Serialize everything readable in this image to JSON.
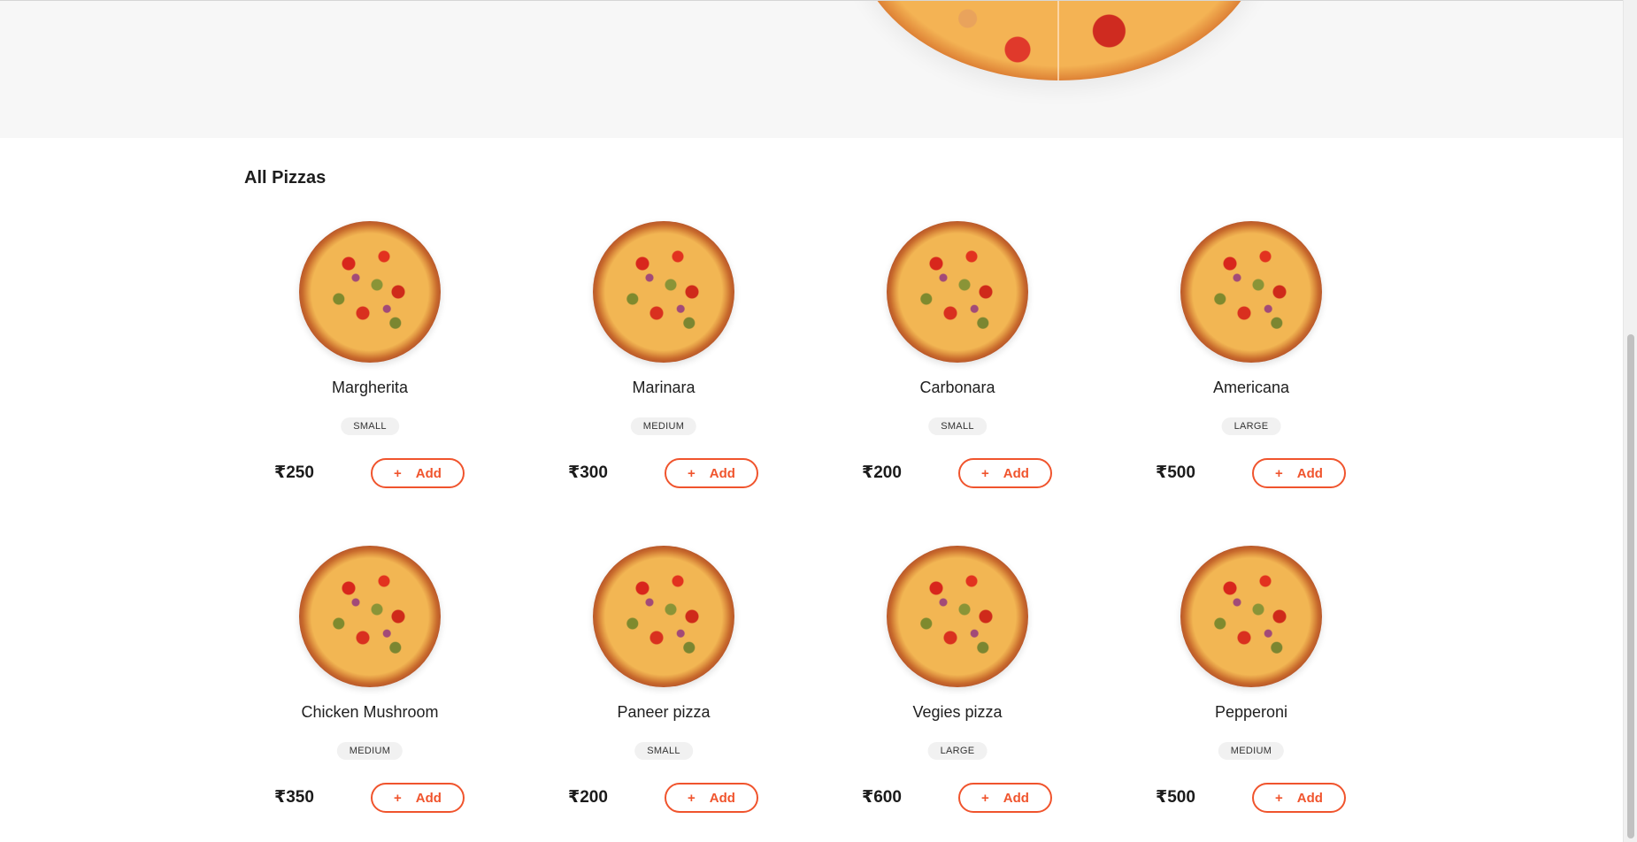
{
  "section": {
    "title": "All Pizzas"
  },
  "currency": "₹",
  "add_button": {
    "plus": "+",
    "label": "Add"
  },
  "colors": {
    "accent": "#f0542d",
    "badge_bg": "#f1f1f1",
    "hero_bg": "#f7f7f7"
  },
  "pizzas": [
    {
      "name": "Margherita",
      "size": "SMALL",
      "price": "₹250"
    },
    {
      "name": "Marinara",
      "size": "MEDIUM",
      "price": "₹300"
    },
    {
      "name": "Carbonara",
      "size": "SMALL",
      "price": "₹200"
    },
    {
      "name": "Americana",
      "size": "LARGE",
      "price": "₹500"
    },
    {
      "name": "Chicken Mushroom",
      "size": "MEDIUM",
      "price": "₹350"
    },
    {
      "name": "Paneer pizza",
      "size": "SMALL",
      "price": "₹200"
    },
    {
      "name": "Vegies pizza",
      "size": "LARGE",
      "price": "₹600"
    },
    {
      "name": "Pepperoni",
      "size": "MEDIUM",
      "price": "₹500"
    }
  ]
}
